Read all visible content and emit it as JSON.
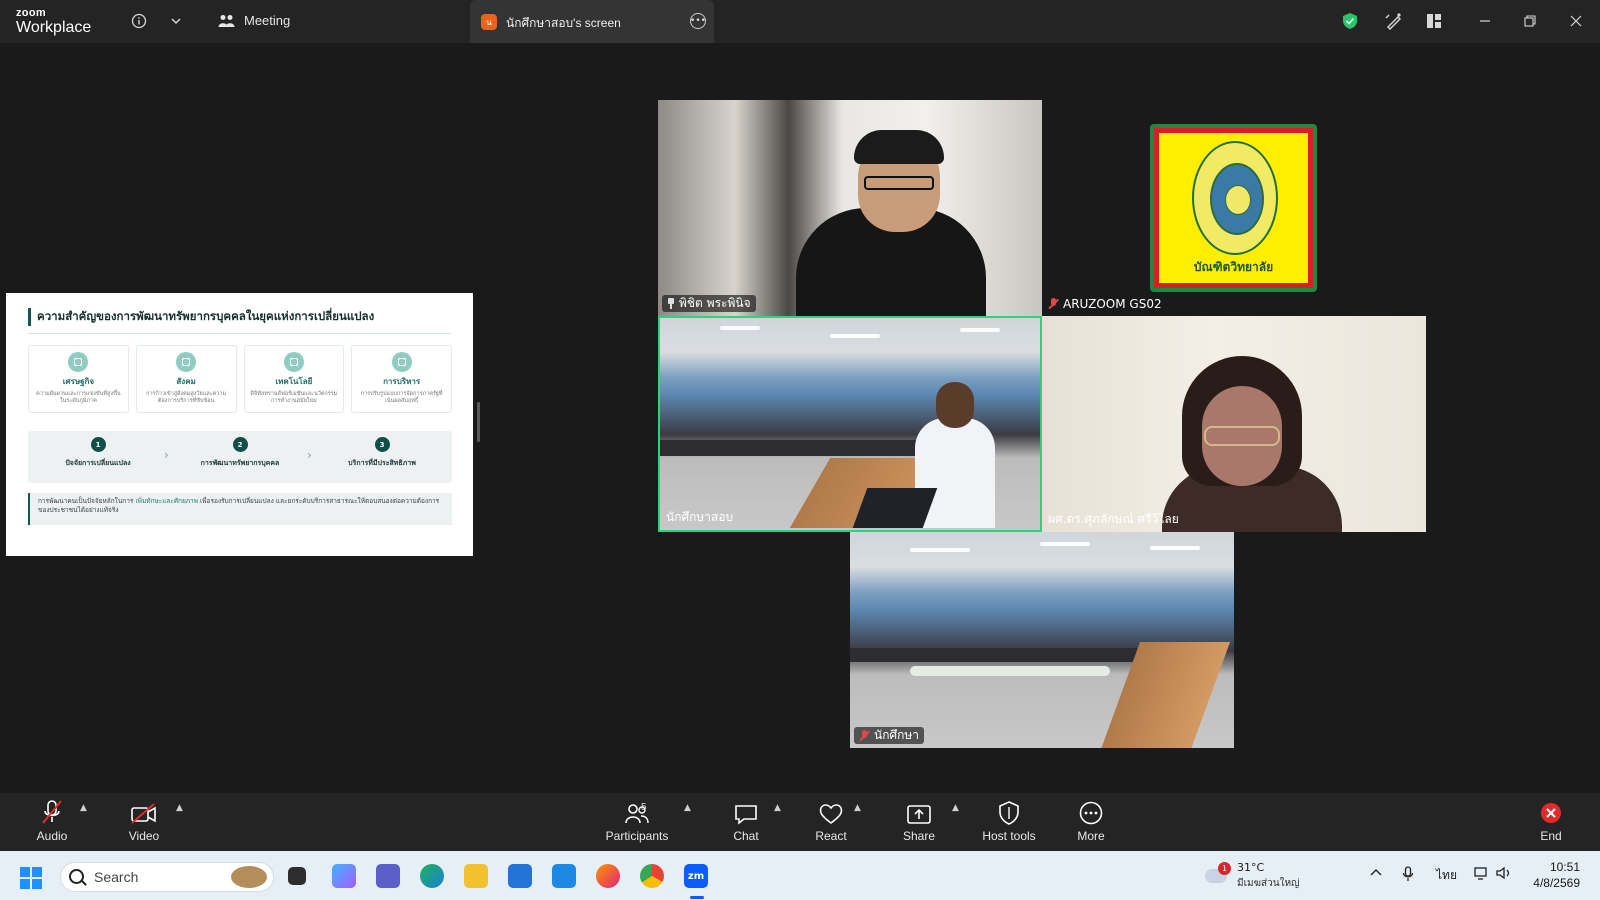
{
  "titlebar": {
    "logo_top": "zoom",
    "logo_bottom": "Workplace",
    "meeting_label": "Meeting",
    "screen_tab_label": "นักศึกษาสอบ's screen",
    "screen_tab_badge": "น"
  },
  "slide": {
    "title": "ความสำคัญของการพัฒนาทรัพยากรบุคคลในยุคแห่งการเปลี่ยนแปลง",
    "cards": [
      {
        "title": "เศรษฐกิจ",
        "desc": "ความผันผวนและการแข่งขันที่สูงขึ้นในระดับภูมิภาค"
      },
      {
        "title": "สังคม",
        "desc": "การก้าวเข้าสู่สังคมสูงวัยและความต้องการบริการที่ซับซ้อน"
      },
      {
        "title": "เทคโนโลยี",
        "desc": "ดิจิทัลทรานส์ฟอร์เมชันและนวัตกรรมการทำงานสมัยใหม่"
      },
      {
        "title": "การบริหาร",
        "desc": "การปรับรูปแบบการจัดการภาครัฐที่เน้นผลสัมฤทธิ์"
      }
    ],
    "steps": [
      {
        "num": "1",
        "label": "ปัจจัยการเปลี่ยนแปลง"
      },
      {
        "num": "2",
        "label": "การพัฒนาทรัพยากรบุคคล"
      },
      {
        "num": "3",
        "label": "บริการที่มีประสิทธิภาพ"
      }
    ],
    "note_pre": "การพัฒนาคนเป็นปัจจัยหลักในการ ",
    "note_highlight": "เพิ่มทักษะและศักยภาพ",
    "note_post": " เพื่อรองรับการเปลี่ยนแปลง และยกระดับบริการสาธารณะให้ตอบสนองต่อความต้องการของประชาชนได้อย่างแท้จริง"
  },
  "participants": [
    {
      "name": "พิชิต พระพินิจ",
      "icon": "pin-icon"
    },
    {
      "name": "ARUZOOM GS02",
      "icon": "mic-muted-icon"
    },
    {
      "name": "นักศึกษาสอบ",
      "icon": "none",
      "active": true
    },
    {
      "name": "ผศ.ดร.ศุภลักษณ์ ศรีวิไลย",
      "icon": "none"
    },
    {
      "name": "นักศึกษา",
      "icon": "mic-muted-icon"
    }
  ],
  "seal": {
    "text": "บัณฑิตวิทยาลัย"
  },
  "toolbar": {
    "audio": "Audio",
    "video": "Video",
    "participants": "Participants",
    "participants_count": "5",
    "chat": "Chat",
    "react": "React",
    "share": "Share",
    "host_tools": "Host tools",
    "more": "More",
    "end": "End"
  },
  "taskbar": {
    "search_placeholder": "Search",
    "weather_badge": "1",
    "weather_temp": "31°C",
    "weather_desc": "มีเมฆส่วนใหญ่",
    "language": "ไทย",
    "time": "10:51",
    "date": "4/8/2569"
  },
  "colors": {
    "active_border": "#2cd37b",
    "end_red": "#e02b2b",
    "shield_green": "#2bc46b",
    "zoom_blue": "#0b5cff"
  }
}
